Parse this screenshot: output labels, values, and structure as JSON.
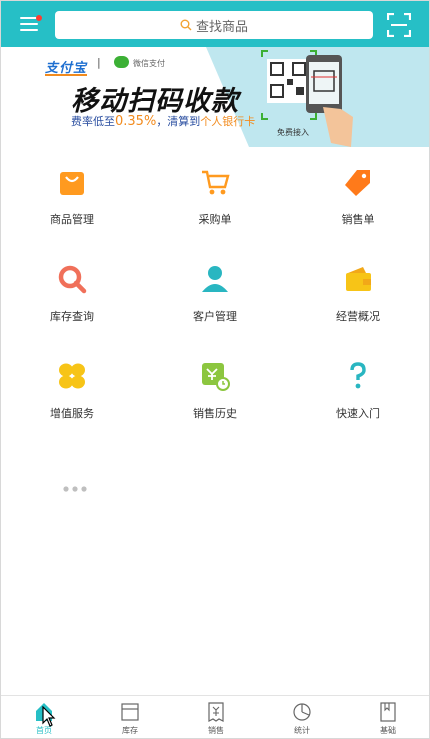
{
  "header": {
    "search_placeholder": "查找商品",
    "menu_icon": "menu-icon",
    "scan_icon": "scan-icon",
    "accent_color": "#26bfc6",
    "notification_dot_color": "#ff3b30"
  },
  "banner": {
    "alipay_brand": "支付宝",
    "separator": "|",
    "wechat_label": "微信支付",
    "title": "移动扫码收款",
    "subtitle_prefix": "费率低至",
    "rate": "0.35%",
    "subtitle_middle": "，清算到",
    "subtitle_cards": "个人银行卡",
    "free_label": "免费接入"
  },
  "grid": {
    "items": [
      {
        "label": "商品管理",
        "icon": "shopping-bag-icon",
        "color": "#ff9a1f"
      },
      {
        "label": "采购单",
        "icon": "shopping-cart-icon",
        "color": "#ff9a1f"
      },
      {
        "label": "销售单",
        "icon": "price-tag-icon",
        "color": "#ff7a1a"
      },
      {
        "label": "库存查询",
        "icon": "inventory-search-icon",
        "color": "#f0705a"
      },
      {
        "label": "客户管理",
        "icon": "person-icon",
        "color": "#29b6c1"
      },
      {
        "label": "经营概况",
        "icon": "wallet-icon",
        "color": "#f7c417"
      },
      {
        "label": "增值服务",
        "icon": "clover-icon",
        "color": "#f7c417"
      },
      {
        "label": "销售历史",
        "icon": "sales-history-icon",
        "color": "#8cc63f"
      },
      {
        "label": "快速入门",
        "icon": "question-mark-icon",
        "color": "#29b6c1"
      }
    ],
    "more_icon": "more-dots-icon"
  },
  "bottom_nav": {
    "tabs": [
      {
        "label": "首页",
        "icon": "home-icon",
        "active": true
      },
      {
        "label": "库存",
        "icon": "inventory-box-icon",
        "active": false
      },
      {
        "label": "销售",
        "icon": "sales-receipt-icon",
        "active": false
      },
      {
        "label": "统计",
        "icon": "pie-chart-icon",
        "active": false
      },
      {
        "label": "基础",
        "icon": "book-icon",
        "active": false
      }
    ]
  }
}
